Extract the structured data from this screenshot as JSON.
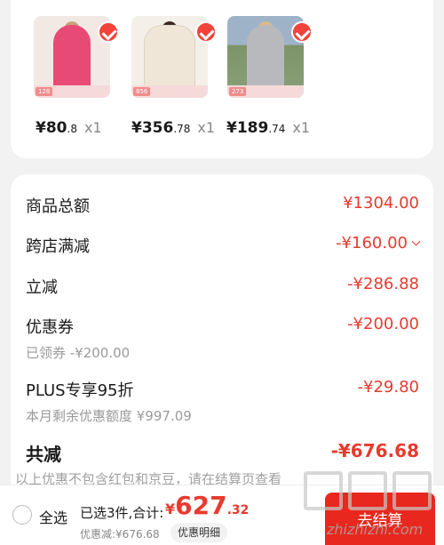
{
  "products": [
    {
      "price_int": "¥80",
      "price_dec": ".8",
      "qty": "x1",
      "tag": "128",
      "colors": {
        "bg": "#f3e9e4",
        "figure": "#e84a76"
      }
    },
    {
      "price_int": "¥356",
      "price_dec": ".78",
      "qty": "x1",
      "tag": "856",
      "colors": {
        "bg": "#f4efe8",
        "figure": "#efe6d8"
      }
    },
    {
      "price_int": "¥189",
      "price_dec": ".74",
      "qty": "x1",
      "tag": "273",
      "colors": {
        "bg": "#8aa07a",
        "figure": "#b8b9bd"
      }
    }
  ],
  "summary": {
    "goods_total": {
      "label": "商品总额",
      "value": "¥1304.00"
    },
    "cross_store": {
      "label": "跨店满减",
      "value": "-¥160.00"
    },
    "instant": {
      "label": "立减",
      "value": "-¥286.88"
    },
    "coupon": {
      "label": "优惠券",
      "value": "-¥200.00",
      "sub": "已领券 -¥200.00"
    },
    "plus": {
      "label": "PLUS专享95折",
      "value": "-¥29.80",
      "sub": "本月剩余优惠额度 ¥997.09"
    },
    "total": {
      "label": "共减",
      "value": "-¥676.68"
    },
    "note": "以上优惠不包含红包和京豆，请在结算页查看"
  },
  "bottom_bar": {
    "select_all": "全选",
    "selected": "已选3件,合计:",
    "cur": "¥",
    "total_int": "627",
    "total_dec": ".32",
    "discount": "优惠减:¥676.68",
    "detail": "优惠明细",
    "checkout": "去结算"
  },
  "watermark": {
    "url": "zhizhizhi.com"
  },
  "colors": {
    "accent": "#e83a2f",
    "check": "#f2433b",
    "checkout": "#e8281e"
  }
}
